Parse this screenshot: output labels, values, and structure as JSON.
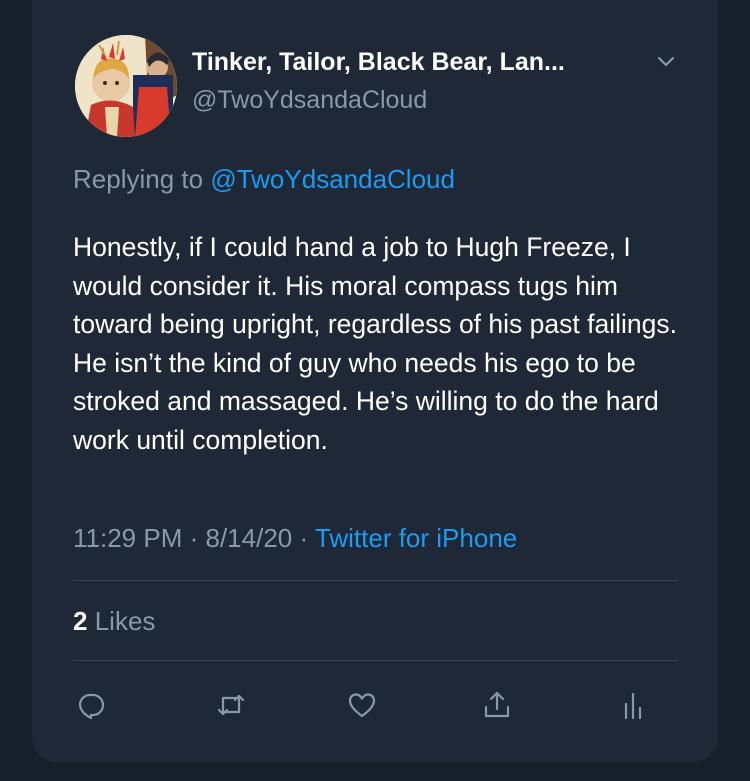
{
  "tweet": {
    "author_name": "Tinker, Tailor, Black Bear, Lan...",
    "author_handle": "@TwoYdsandaCloud",
    "replying_to_prefix": "Replying to",
    "replying_to_handle": "@TwoYdsandaCloud",
    "text": "Honestly, if I could hand a job to Hugh Freeze, I would consider it. His moral compass tugs him toward being upright, regardless of his past failings. He isn’t the kind of guy who needs his ego to be stroked and massaged. He’s willing to do the hard work until completion.",
    "time": "11:29 PM",
    "separator": "·",
    "date": "8/14/20",
    "source": "Twitter for iPhone",
    "likes_count": "2",
    "likes_label": "Likes"
  },
  "actions": {
    "icons": [
      "reply-icon",
      "retweet-icon",
      "like-icon",
      "share-icon",
      "analytics-icon"
    ]
  },
  "colors": {
    "background": "#15202b",
    "card": "#1e2836",
    "primary_text": "#ffffff",
    "secondary_text": "#8b98a5",
    "accent": "#1d9bf0",
    "divider": "#38444d"
  }
}
